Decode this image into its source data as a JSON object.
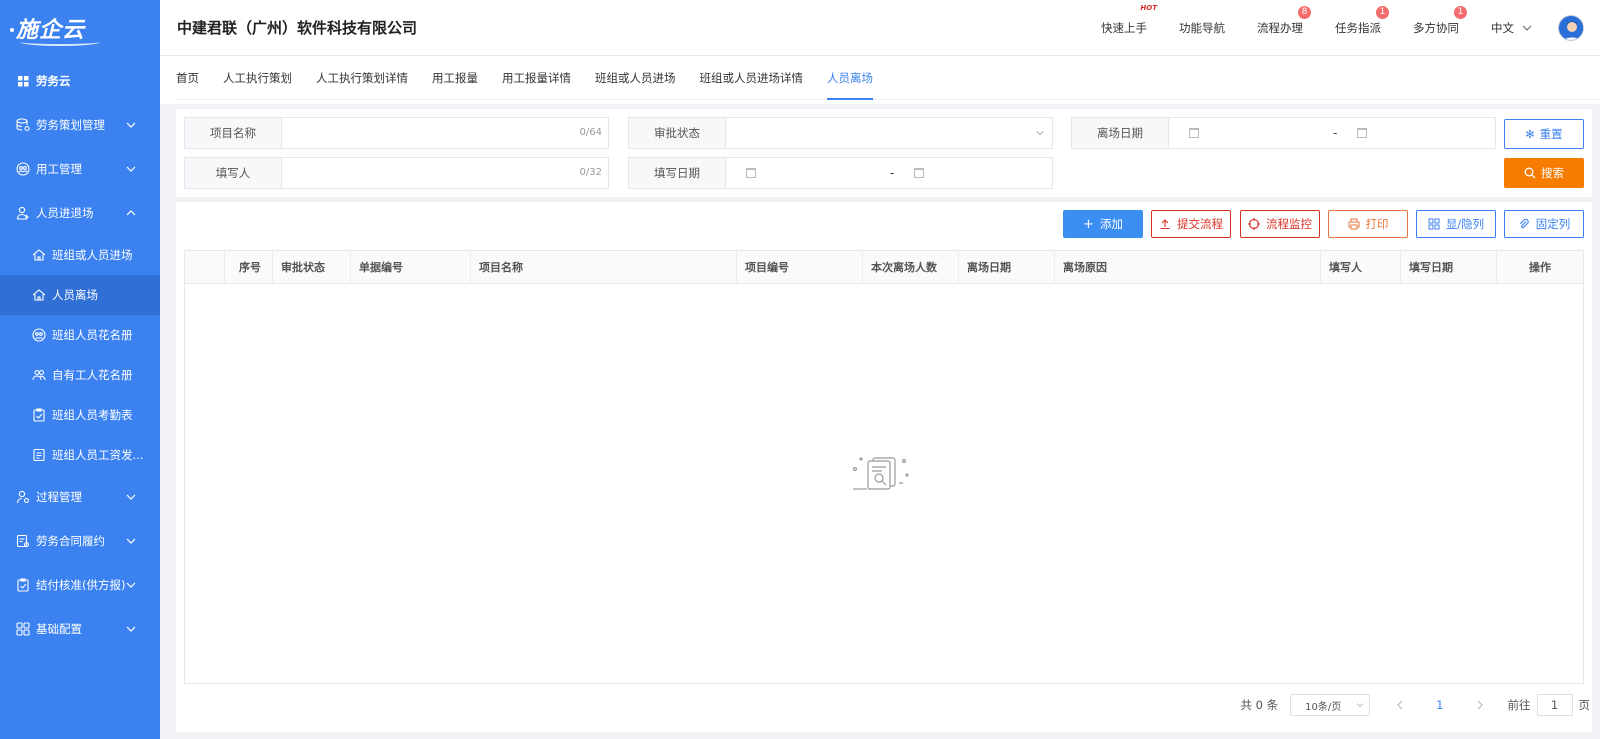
{
  "sidebar": {
    "logo": "施企云",
    "top_item": "劳务云",
    "groups": [
      {
        "label": "劳务策划管理",
        "expanded": false
      },
      {
        "label": "用工管理",
        "expanded": false
      },
      {
        "label": "人员进退场",
        "expanded": true
      }
    ],
    "subitems": [
      {
        "label": "班组或人员进场",
        "active": false
      },
      {
        "label": "人员离场",
        "active": true
      },
      {
        "label": "班组人员花名册",
        "active": false
      },
      {
        "label": "自有工人花名册",
        "active": false
      },
      {
        "label": "班组人员考勤表",
        "active": false
      },
      {
        "label": "班组人员工资发..."
      }
    ],
    "groups_after": [
      {
        "label": "过程管理"
      },
      {
        "label": "劳务合同履约"
      },
      {
        "label": "结付核准(供方报)"
      },
      {
        "label": "基础配置"
      }
    ]
  },
  "header": {
    "company": "中建君联（广州）软件科技有限公司",
    "links": [
      {
        "label": "快速上手",
        "hot": "HOT"
      },
      {
        "label": "功能导航"
      },
      {
        "label": "流程办理",
        "badge": "8"
      },
      {
        "label": "任务指派",
        "badge": "1"
      },
      {
        "label": "多方协同",
        "badge": "1"
      }
    ],
    "language": "中文"
  },
  "tabs": [
    "首页",
    "人工执行策划",
    "人工执行策划详情",
    "用工报量",
    "用工报量详情",
    "班组或人员进场",
    "班组或人员进场详情",
    "人员离场"
  ],
  "active_tab": "人员离场",
  "filter": {
    "project_name": {
      "label": "项目名称",
      "count": "0/64"
    },
    "approval_status": {
      "label": "审批状态"
    },
    "leave_date": {
      "label": "离场日期",
      "sep": "-"
    },
    "filler": {
      "label": "填写人",
      "count": "0/32"
    },
    "fill_date": {
      "label": "填写日期",
      "sep": "-"
    },
    "reset_label": "重置",
    "search_label": "搜索"
  },
  "toolbar": {
    "add": "添加",
    "submit_flow": "提交流程",
    "flow_monitor": "流程监控",
    "print": "打印",
    "show_hide_cols": "显/隐列",
    "fix_cols": "固定列"
  },
  "table": {
    "columns": [
      "序号",
      "审批状态",
      "单据编号",
      "项目名称",
      "项目编号",
      "本次离场人数",
      "离场日期",
      "离场原因",
      "填写人",
      "填写日期",
      "操作"
    ],
    "rows": []
  },
  "pager": {
    "total": "共 0 条",
    "page_size": "10条/页",
    "current_page": "1",
    "goto_label": "前往",
    "goto_value": "1",
    "page_suffix": "页"
  },
  "colors": {
    "sidebar_bg": "#3b82f0",
    "primary": "#3b82f0",
    "search_btn": "#f57c00",
    "danger": "#d93026"
  }
}
